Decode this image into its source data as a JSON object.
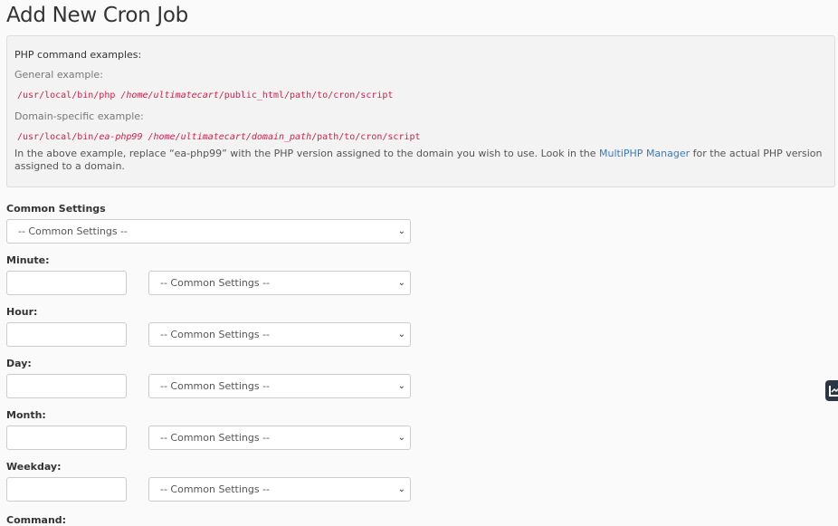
{
  "page_title": "Add New Cron Job",
  "examples": {
    "title": "PHP command examples:",
    "general_label": "General example:",
    "general_cmd": {
      "bin": "/usr/local/bin/php ",
      "home": "/home/ultimatecart",
      "rest": "/public_html/path/to/cron/script"
    },
    "domain_label": "Domain-specific example:",
    "domain_cmd": {
      "bin": "/usr/local/bin/",
      "ver": "ea-php99",
      "home": " /home/ultimatecart/domain_path",
      "rest": "/path/to/cron/script"
    },
    "note_before": "In the above example, replace “ea-php99” with the PHP version assigned to the domain you wish to use. Look in the ",
    "note_link": "MultiPHP Manager",
    "note_after": " for the actual PHP version assigned to a domain."
  },
  "common_settings": {
    "label": "Common Settings",
    "selected": "-- Common Settings --"
  },
  "fields": [
    {
      "label": "Minute:",
      "value": "",
      "select": "-- Common Settings --"
    },
    {
      "label": "Hour:",
      "value": "",
      "select": "-- Common Settings --"
    },
    {
      "label": "Day:",
      "value": "",
      "select": "-- Common Settings --"
    },
    {
      "label": "Month:",
      "value": "",
      "select": "-- Common Settings --"
    },
    {
      "label": "Weekday:",
      "value": "",
      "select": "-- Common Settings --"
    }
  ],
  "command_label": "Command:",
  "icons": {
    "chevron": "⌄",
    "side_tab": "chart-icon"
  }
}
